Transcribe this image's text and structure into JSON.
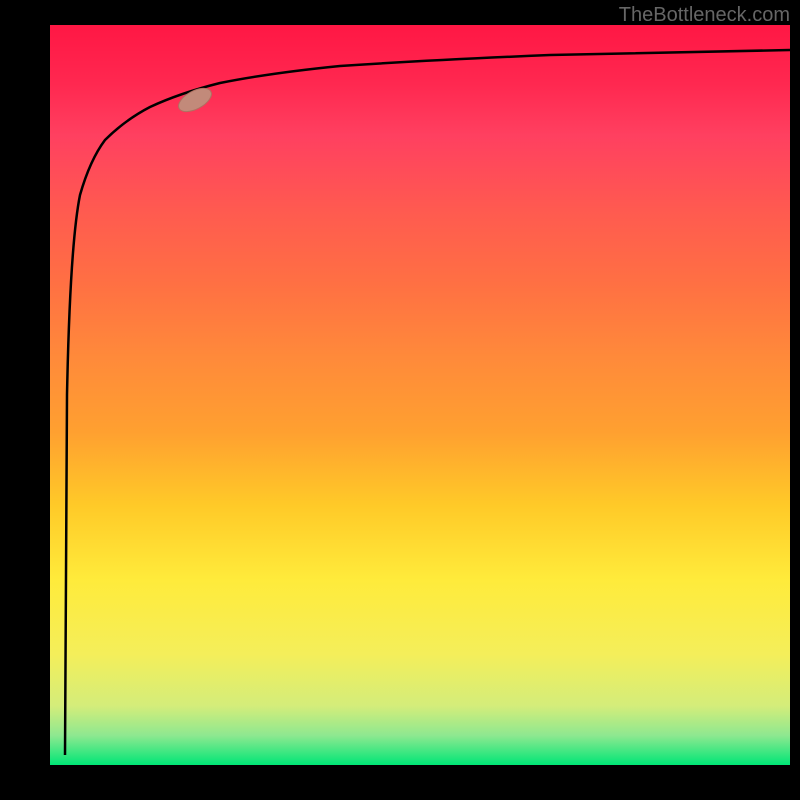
{
  "watermark": "TheBottleneck.com",
  "chart_data": {
    "type": "line",
    "title": "",
    "xlabel": "",
    "ylabel": "",
    "x_range": [
      0,
      100
    ],
    "y_range": [
      0,
      100
    ],
    "series": [
      {
        "name": "curve",
        "description": "Steep initial spike from bottom to near top, then asymptotic approach to top",
        "control_points": [
          {
            "x": 2,
            "y": 2
          },
          {
            "x": 2.3,
            "y": 50
          },
          {
            "x": 3,
            "y": 70
          },
          {
            "x": 5,
            "y": 78
          },
          {
            "x": 8,
            "y": 83
          },
          {
            "x": 12,
            "y": 86
          },
          {
            "x": 18,
            "y": 89
          },
          {
            "x": 25,
            "y": 91
          },
          {
            "x": 35,
            "y": 93
          },
          {
            "x": 50,
            "y": 94.5
          },
          {
            "x": 70,
            "y": 95.5
          },
          {
            "x": 100,
            "y": 96.5
          }
        ]
      }
    ],
    "marker": {
      "x": 19,
      "y": 89.5,
      "color": "#c28a7a"
    },
    "background": {
      "type": "vertical-gradient",
      "stops": [
        "#ff1744",
        "#ff7043",
        "#ffeb3b",
        "#00e676"
      ]
    }
  }
}
